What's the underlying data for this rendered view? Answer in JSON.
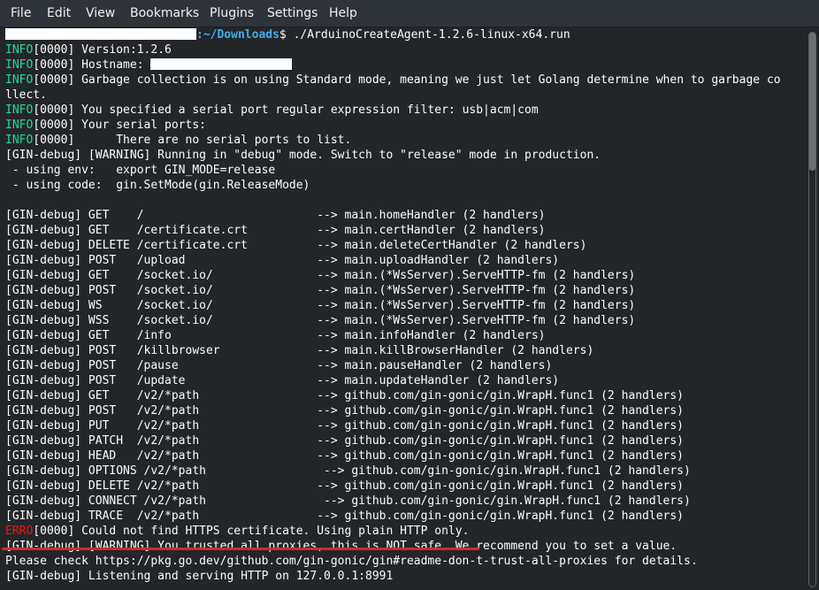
{
  "menu": {
    "items": [
      "File",
      "Edit",
      "View",
      "Bookmarks",
      "Plugins",
      "Settings",
      "Help"
    ]
  },
  "colors": {
    "background": "#232629",
    "info": "#1cdc9a",
    "error": "#ed1515",
    "path": "#3daee9",
    "underline": "#d62828"
  },
  "terminal": {
    "prompt": {
      "path": ":~/Downloads",
      "symbol": "$",
      "command": " ./ArduinoCreateAgent-1.2.6-linux-x64.run"
    },
    "log": [
      {
        "tag": "INFO",
        "text": "[0000] Version:1.2.6"
      },
      {
        "tag": "INFO",
        "text": "[0000] Hostname: ",
        "redacted": true
      },
      {
        "tag": "INFO",
        "text": "[0000] Garbage collection is on using Standard mode, meaning we just let Golang determine when to garbage co"
      },
      {
        "tag": "",
        "text": "llect."
      },
      {
        "tag": "INFO",
        "text": "[0000] You specified a serial port regular expression filter: usb|acm|com"
      },
      {
        "tag": "INFO",
        "text": "[0000] Your serial ports:"
      },
      {
        "tag": "INFO",
        "text": "[0000]      There are no serial ports to list."
      },
      {
        "tag": "",
        "text": "[GIN-debug] [WARNING] Running in \"debug\" mode. Switch to \"release\" mode in production."
      },
      {
        "tag": "",
        "text": " - using env:   export GIN_MODE=release"
      },
      {
        "tag": "",
        "text": " - using code:  gin.SetMode(gin.ReleaseMode)"
      },
      {
        "tag": "",
        "text": ""
      },
      {
        "tag": "",
        "text": "[GIN-debug] GET    /                         --> main.homeHandler (2 handlers)"
      },
      {
        "tag": "",
        "text": "[GIN-debug] GET    /certificate.crt          --> main.certHandler (2 handlers)"
      },
      {
        "tag": "",
        "text": "[GIN-debug] DELETE /certificate.crt          --> main.deleteCertHandler (2 handlers)"
      },
      {
        "tag": "",
        "text": "[GIN-debug] POST   /upload                   --> main.uploadHandler (2 handlers)"
      },
      {
        "tag": "",
        "text": "[GIN-debug] GET    /socket.io/               --> main.(*WsServer).ServeHTTP-fm (2 handlers)"
      },
      {
        "tag": "",
        "text": "[GIN-debug] POST   /socket.io/               --> main.(*WsServer).ServeHTTP-fm (2 handlers)"
      },
      {
        "tag": "",
        "text": "[GIN-debug] WS     /socket.io/               --> main.(*WsServer).ServeHTTP-fm (2 handlers)"
      },
      {
        "tag": "",
        "text": "[GIN-debug] WSS    /socket.io/               --> main.(*WsServer).ServeHTTP-fm (2 handlers)"
      },
      {
        "tag": "",
        "text": "[GIN-debug] GET    /info                     --> main.infoHandler (2 handlers)"
      },
      {
        "tag": "",
        "text": "[GIN-debug] POST   /killbrowser              --> main.killBrowserHandler (2 handlers)"
      },
      {
        "tag": "",
        "text": "[GIN-debug] POST   /pause                    --> main.pauseHandler (2 handlers)"
      },
      {
        "tag": "",
        "text": "[GIN-debug] POST   /update                   --> main.updateHandler (2 handlers)"
      },
      {
        "tag": "",
        "text": "[GIN-debug] GET    /v2/*path                 --> github.com/gin-gonic/gin.WrapH.func1 (2 handlers)"
      },
      {
        "tag": "",
        "text": "[GIN-debug] POST   /v2/*path                 --> github.com/gin-gonic/gin.WrapH.func1 (2 handlers)"
      },
      {
        "tag": "",
        "text": "[GIN-debug] PUT    /v2/*path                 --> github.com/gin-gonic/gin.WrapH.func1 (2 handlers)"
      },
      {
        "tag": "",
        "text": "[GIN-debug] PATCH  /v2/*path                 --> github.com/gin-gonic/gin.WrapH.func1 (2 handlers)"
      },
      {
        "tag": "",
        "text": "[GIN-debug] HEAD   /v2/*path                 --> github.com/gin-gonic/gin.WrapH.func1 (2 handlers)"
      },
      {
        "tag": "",
        "text": "[GIN-debug] OPTIONS /v2/*path                 --> github.com/gin-gonic/gin.WrapH.func1 (2 handlers)"
      },
      {
        "tag": "",
        "text": "[GIN-debug] DELETE /v2/*path                 --> github.com/gin-gonic/gin.WrapH.func1 (2 handlers)"
      },
      {
        "tag": "",
        "text": "[GIN-debug] CONNECT /v2/*path                 --> github.com/gin-gonic/gin.WrapH.func1 (2 handlers)"
      },
      {
        "tag": "",
        "text": "[GIN-debug] TRACE  /v2/*path                 --> github.com/gin-gonic/gin.WrapH.func1 (2 handlers)"
      },
      {
        "tag": "ERRO",
        "text": "[0000] Could not find HTTPS certificate. Using plain HTTP only."
      },
      {
        "tag": "",
        "text": "[GIN-debug] [WARNING] You trusted all proxies, this is NOT safe. We recommend you to set a value."
      },
      {
        "tag": "",
        "text": "Please check https://pkg.go.dev/github.com/gin-gonic/gin#readme-don-t-trust-all-proxies for details."
      },
      {
        "tag": "",
        "text": "[GIN-debug] Listening and serving HTTP on 127.0.0.1:8991"
      }
    ]
  }
}
